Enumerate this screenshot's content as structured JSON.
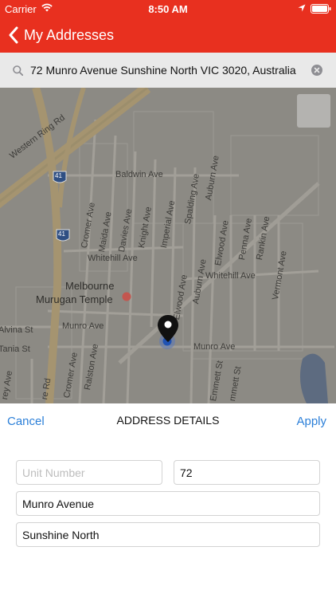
{
  "status_bar": {
    "carrier": "Carrier",
    "time": "8:50 AM"
  },
  "nav": {
    "back_label": "My Addresses"
  },
  "search": {
    "value": "72 Munro Avenue Sunshine North VIC 3020, Australia"
  },
  "map": {
    "labels": {
      "western_ring_rd": "Western Ring Rd",
      "shield_41_top": "41",
      "shield_41_bottom": "41",
      "baldwin_ave": "Baldwin Ave",
      "auburn_ave_top": "Auburn Ave",
      "spalding_ave": "Spalding Ave",
      "imperial_ave": "Imperial Ave",
      "knight_ave": "Knight Ave",
      "davies_ave": "Davies Ave",
      "maida_ave": "Maida Ave",
      "cromer_ave_top": "Cromer Ave",
      "whitehill_ave_left": "Whitehill Ave",
      "whitehill_ave_right": "Whitehill Ave",
      "elwood_ave_top": "Elwood Ave",
      "penna_ave": "Penna Ave",
      "rankin_ave": "Rankin Ave",
      "vermont_ave": "Vermont Ave",
      "auburn_ave_mid": "Auburn Ave",
      "elwood_ave_mid": "Elwood Ave",
      "temple_line1": "Melbourne",
      "temple_line2": "Murugan Temple",
      "alvina_st": "Alvina St",
      "tania_st": "Tania St",
      "munro_ave_left": "Munro Ave",
      "munro_ave_right": "Munro Ave",
      "ralston_ave": "Ralston Ave",
      "cromer_ave_bottom": "Cromer Ave",
      "re_rd": "re Rd",
      "rey_ave": "rey Ave",
      "emmett_st": "Emmett St",
      "mmett_st": "mmett St"
    }
  },
  "panel": {
    "cancel_label": "Cancel",
    "title": "ADDRESS DETAILS",
    "apply_label": "Apply",
    "unit_placeholder": "Unit Number",
    "unit_value": "",
    "street_number": "72",
    "street_name": "Munro Avenue",
    "suburb": "Sunshine North"
  },
  "colors": {
    "brand_red": "#e8301f",
    "link_blue": "#2b7fd8"
  }
}
